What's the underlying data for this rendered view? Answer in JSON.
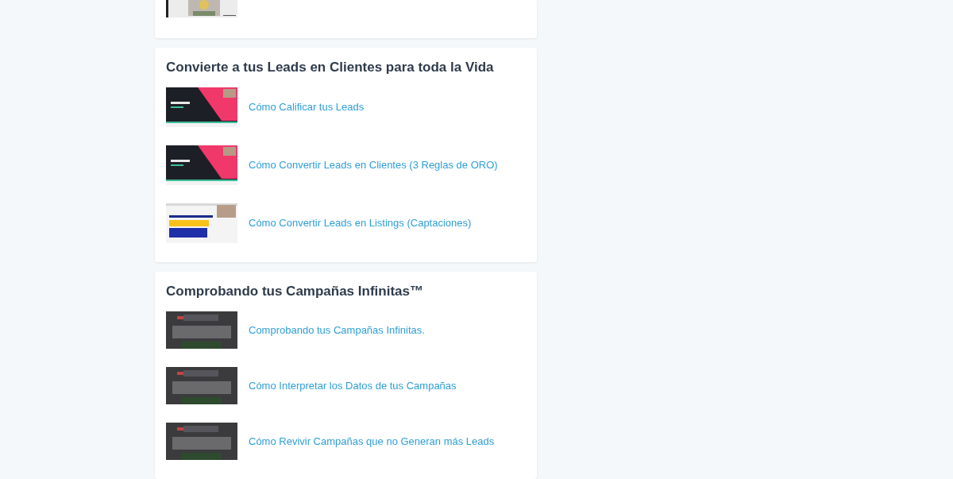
{
  "sections": [
    {
      "lessons": [
        {
          "kind": "picture"
        }
      ]
    },
    {
      "title": "Convierte a tus Leads en Clientes para toda la Vida",
      "lessons": [
        {
          "kind": "picture",
          "label": "Cómo Calificar tus Leads"
        },
        {
          "kind": "picture",
          "label": "Cómo Convertir Leads en Clientes (3 Reglas de ORO)"
        },
        {
          "kind": "picture",
          "label": "Cómo Convertir Leads en Listings (Captaciones)"
        }
      ]
    },
    {
      "title": "Comprobando tus Campañas Infinitas™",
      "lessons": [
        {
          "kind": "picture",
          "label": "Comprobando tus Campañas Infinitas."
        },
        {
          "kind": "picture",
          "label": "Cómo Interpretar los Datos de tus Campañas"
        },
        {
          "kind": "picture",
          "label": "Cómo Revivir Campañas que no Generan más Leads"
        }
      ]
    }
  ]
}
